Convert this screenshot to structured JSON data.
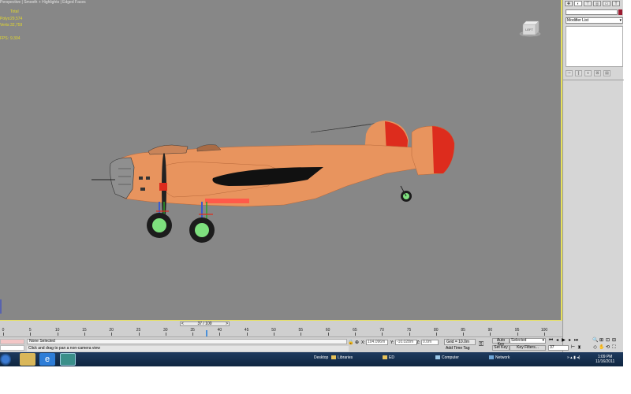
{
  "viewport": {
    "label": "Perspective | Smooth + Highlights | Edged Faces",
    "stats": [
      {
        "key": "",
        "value": "Total"
      },
      {
        "key": "Polys:",
        "value": "29,574"
      },
      {
        "key": "Verts:",
        "value": "32,759"
      },
      {
        "key": "",
        "value": ""
      },
      {
        "key": "FPS:",
        "value": "9.304"
      }
    ],
    "viewcube_label": "LEFT"
  },
  "command_panel": {
    "tabs": [
      "create-icon",
      "modify-icon",
      "hierarchy-icon",
      "motion-icon",
      "display-icon",
      "utilities-icon"
    ],
    "modifier_list": "Modifier List",
    "color_swatch": "#9b1b30"
  },
  "timeline": {
    "frame_indicator": "37 / 100",
    "ticks": [
      "0",
      "5",
      "10",
      "15",
      "20",
      "25",
      "30",
      "35",
      "40",
      "45",
      "50",
      "55",
      "60",
      "65",
      "70",
      "75",
      "80",
      "85",
      "90",
      "95",
      "100"
    ]
  },
  "status": {
    "selection": "None Selected",
    "prompt": "Click and drag to pan a non-camera view",
    "x_label": "X:",
    "x_value": "104.096m",
    "y_label": "Y:",
    "y_value": "-10.028m",
    "z_label": "Z:",
    "z_value": "0.0m",
    "grid": "Grid = 10.0m",
    "add_time_tag": "Add Time Tag"
  },
  "anim": {
    "auto_key": "Auto Key",
    "set_key": "Set Key",
    "key_mode": "Selected",
    "key_filters": "Key Filters...",
    "current_frame": "37"
  },
  "taskbar": {
    "desktop": "Desktop",
    "libraries": "Libraries",
    "ed": "ED",
    "computer": "Computer",
    "network": "Network",
    "time": "1:09 PM",
    "date": "11/16/2011"
  }
}
